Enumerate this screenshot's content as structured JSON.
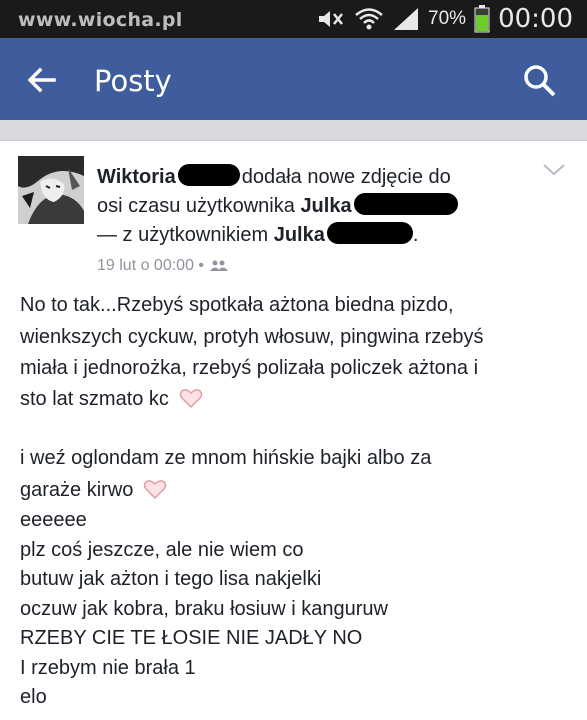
{
  "statusbar": {
    "watermark": "www.wiocha.pl",
    "battery": "70%",
    "time": "00:00",
    "icons": [
      "mute-icon",
      "wifi-icon",
      "signal-icon",
      "battery-icon"
    ]
  },
  "appbar": {
    "title": "Posty",
    "back_icon": "arrow-left-icon",
    "search_icon": "search-icon",
    "color": "#3f5d9c"
  },
  "post": {
    "author": "Wiktoria",
    "action_text": "dodała nowe zdjęcie do",
    "line2_text": "osi czasu użytkownika",
    "tagged_name": "Julka",
    "line3_prefix": "— z użytkownikiem",
    "with_name": "Julka",
    "line3_suffix": ".",
    "meta_date": "19 lut o 00:00 •",
    "meta_icon": "friends-icon",
    "lines": [
      "No to tak...Rzebyś spotkała ażtona biedna pizdo,",
      "wienkszych cyckuw, protyh włosuw, pingwina rzebyś",
      "miała i jednorożka, rzebyś polizała policzek ażtona i",
      "sto lat szmato kc",
      "i weź oglondam ze mnom hińskie bajki albo za",
      "garaże kirwo",
      "eeeeee",
      "plz coś jeszcze, ale nie wiem co",
      "butuw jak ażton i tego lisa nakjelki",
      "oczuw jak kobra, braku łosiuw i kanguruw",
      "RZEBY CIE TE ŁOSIE NIE JADŁY NO",
      "I rzebym nie brała 1",
      "elo"
    ]
  }
}
